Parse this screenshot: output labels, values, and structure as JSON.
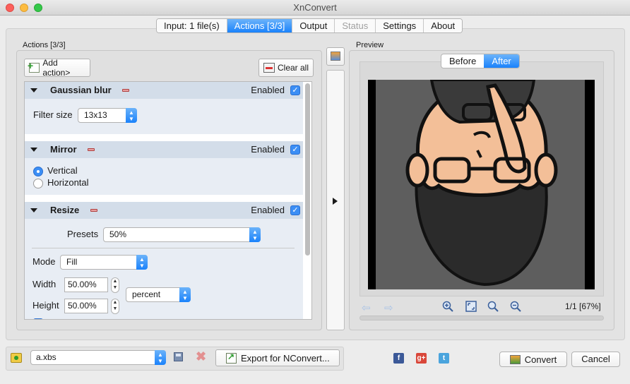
{
  "window": {
    "title": "XnConvert"
  },
  "tabs": [
    {
      "label": "Input: 1 file(s)",
      "state": "normal"
    },
    {
      "label": "Actions [3/3]",
      "state": "active"
    },
    {
      "label": "Output",
      "state": "normal"
    },
    {
      "label": "Status",
      "state": "disabled"
    },
    {
      "label": "Settings",
      "state": "normal"
    },
    {
      "label": "About",
      "state": "normal"
    }
  ],
  "actions_panel": {
    "group_label": "Actions [3/3]",
    "add_action_label": "Add action>",
    "clear_all_label": "Clear all",
    "gaussian_blur": {
      "title": "Gaussian blur",
      "enabled_label": "Enabled",
      "enabled": true,
      "filter_size_label": "Filter size",
      "filter_size_value": "13x13"
    },
    "mirror": {
      "title": "Mirror",
      "enabled_label": "Enabled",
      "enabled": true,
      "options": [
        "Vertical",
        "Horizontal"
      ],
      "selected": "Vertical"
    },
    "resize": {
      "title": "Resize",
      "enabled_label": "Enabled",
      "enabled": true,
      "presets_label": "Presets",
      "presets_value": "50%",
      "mode_label": "Mode",
      "mode_value": "Fill",
      "width_label": "Width",
      "width_value": "50.00%",
      "height_label": "Height",
      "height_value": "50.00%",
      "unit_value": "percent"
    }
  },
  "preview": {
    "group_label": "Preview",
    "before_label": "Before",
    "after_label": "After",
    "selected": "After",
    "counter": "1/1 [67%]"
  },
  "bottom": {
    "preset_value": "a.xbs",
    "export_label": "Export for NConvert...",
    "convert_label": "Convert",
    "cancel_label": "Cancel"
  },
  "icons": {
    "social": [
      "facebook-icon",
      "google-plus-icon",
      "twitter-icon"
    ]
  },
  "colors": {
    "accent": "#1a82fb",
    "section_header": "#d3dde9",
    "preview_background": "#5e5e5e",
    "skin": "#f3bf98",
    "beard": "#2b2b2b"
  }
}
